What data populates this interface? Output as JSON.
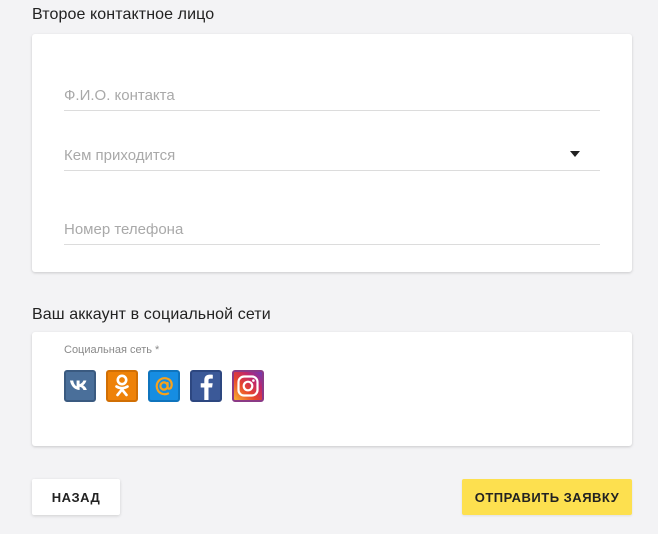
{
  "second_contact": {
    "title": "Второе контактное лицо",
    "name_placeholder": "Ф.И.О. контакта",
    "relation_placeholder": "Кем приходится",
    "phone_placeholder": "Номер телефона"
  },
  "social": {
    "title": "Ваш аккаунт в социальной сети",
    "label": "Социальная сеть *",
    "networks": [
      {
        "name": "vk",
        "icon": "vk-icon",
        "color": "#4a6f9a"
      },
      {
        "name": "odnoklassniki",
        "icon": "odnoklassniki-icon",
        "color": "#ee8208"
      },
      {
        "name": "mail.ru",
        "icon": "at-sign-icon",
        "color": "#168de2"
      },
      {
        "name": "facebook",
        "icon": "facebook-icon",
        "color": "#3b5998"
      },
      {
        "name": "instagram",
        "icon": "instagram-icon",
        "color": "#c0256b"
      }
    ]
  },
  "actions": {
    "back_label": "НАЗАД",
    "submit_label": "ОТПРАВИТЬ ЗАЯВКУ",
    "submit_color": "#fde04f"
  }
}
